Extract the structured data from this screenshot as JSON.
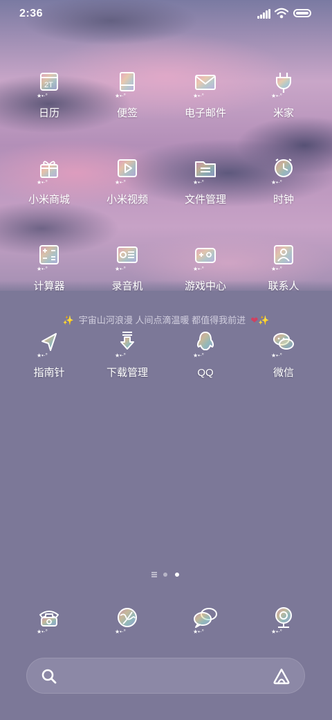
{
  "status_bar": {
    "time": "2:36"
  },
  "apps": [
    {
      "label": "日历",
      "stars": "★•·°",
      "icon": "calendar-icon"
    },
    {
      "label": "便签",
      "stars": "★•·°",
      "icon": "notes-icon"
    },
    {
      "label": "电子邮件",
      "stars": "★•·°",
      "icon": "mail-icon"
    },
    {
      "label": "米家",
      "stars": "★•·°",
      "icon": "plug-icon"
    },
    {
      "label": "小米商城",
      "stars": "★•·°",
      "icon": "gift-icon"
    },
    {
      "label": "小米视频",
      "stars": "★•·°",
      "icon": "video-icon"
    },
    {
      "label": "文件管理",
      "stars": "★•·°",
      "icon": "folder-icon"
    },
    {
      "label": "时钟",
      "stars": "★•·°",
      "icon": "clock-icon"
    },
    {
      "label": "计算器",
      "stars": "★•·°",
      "icon": "calculator-icon"
    },
    {
      "label": "录音机",
      "stars": "★•·°",
      "icon": "recorder-icon"
    },
    {
      "label": "游戏中心",
      "stars": "★•·°",
      "icon": "gamepad-icon"
    },
    {
      "label": "联系人",
      "stars": "★•·°",
      "icon": "contacts-icon"
    },
    {
      "label": "指南针",
      "stars": "★•·°",
      "icon": "compass-icon"
    },
    {
      "label": "下载管理",
      "stars": "★•·°",
      "icon": "download-icon"
    },
    {
      "label": "QQ",
      "stars": "★•·°",
      "icon": "qq-icon"
    },
    {
      "label": "微信",
      "stars": "★•·°",
      "icon": "wechat-icon"
    }
  ],
  "quote": {
    "text": "宇宙山河浪漫 人间点滴温暖 都值得我前进"
  },
  "dock": [
    {
      "stars": "★•·°",
      "icon": "phone-icon"
    },
    {
      "stars": "★•·°",
      "icon": "browser-icon"
    },
    {
      "stars": "★•·°",
      "icon": "messages-icon"
    },
    {
      "stars": "★•·°",
      "icon": "camera-icon"
    }
  ],
  "pager": {
    "current": 3,
    "total": 3
  },
  "search": {
    "placeholder": ""
  },
  "colors": {
    "background": "#7c7898",
    "rainbow": [
      "#f4a3c0",
      "#f6e39a",
      "#9fe3d0",
      "#a9b8f3"
    ]
  }
}
